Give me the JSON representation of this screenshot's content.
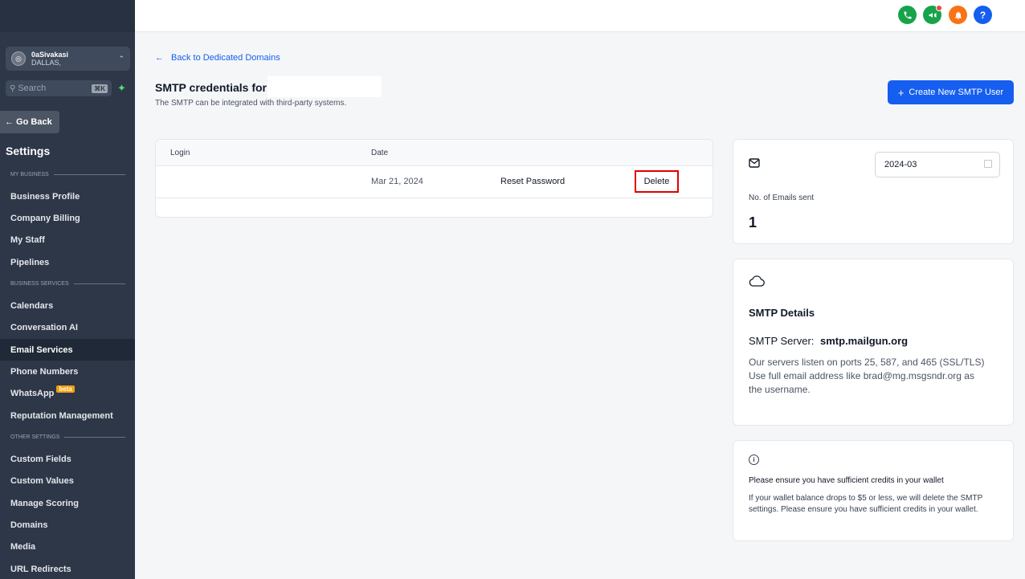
{
  "sidebar": {
    "account": {
      "name": "0aSivakasi",
      "location": "DALLAS,"
    },
    "search": {
      "label": "Search",
      "shortcut": "⌘K"
    },
    "go_back": "← Go Back",
    "settings_title": "Settings",
    "sections": [
      "MY BUSINESS",
      "BUSINESS SERVICES",
      "OTHER SETTINGS"
    ],
    "items": [
      {
        "label": "Business Profile"
      },
      {
        "label": "Company Billing"
      },
      {
        "label": "My Staff"
      },
      {
        "label": "Pipelines"
      },
      {
        "label": "Calendars"
      },
      {
        "label": "Conversation AI"
      },
      {
        "label": "Email Services"
      },
      {
        "label": "Phone Numbers"
      },
      {
        "label": "WhatsApp",
        "badge": "beta"
      },
      {
        "label": "Reputation Management"
      },
      {
        "label": "Custom Fields"
      },
      {
        "label": "Custom Values"
      },
      {
        "label": "Manage Scoring"
      },
      {
        "label": "Domains"
      },
      {
        "label": "Media"
      },
      {
        "label": "URL Redirects"
      }
    ]
  },
  "topbar": {
    "help_label": "?",
    "colors": {
      "phone": "#16a34a",
      "announce": "#16a34a",
      "bell": "#f97316",
      "help": "#155eef"
    }
  },
  "main": {
    "back_link": "Back to Dedicated Domains",
    "title": "SMTP credentials for",
    "subtitle": "The SMTP can be integrated with third-party systems.",
    "create_button": "Create New SMTP User",
    "table": {
      "headers": {
        "login": "Login",
        "date": "Date"
      },
      "rows": [
        {
          "login": "",
          "date": "Mar 21, 2024",
          "reset": "Reset Password",
          "delete": "Delete"
        }
      ]
    }
  },
  "stats_card": {
    "month": "2024-03",
    "label": "No. of Emails sent",
    "count": "1"
  },
  "smtp_card": {
    "title": "SMTP Details",
    "server_label": "SMTP Server:",
    "server_value": "smtp.mailgun.org",
    "desc_ports": "Our servers listen on ports 25, 587, and 465 (SSL/TLS)",
    "desc_username": "Use full email address like brad@mg.msgsndr.org as the username."
  },
  "wallet_card": {
    "title": "Please ensure you have sufficient credits in your wallet",
    "desc": "If your wallet balance drops to $5 or less, we will delete the SMTP settings. Please ensure you have sufficient credits in your wallet."
  },
  "accent": "#155eef",
  "highlight": "#e00000"
}
